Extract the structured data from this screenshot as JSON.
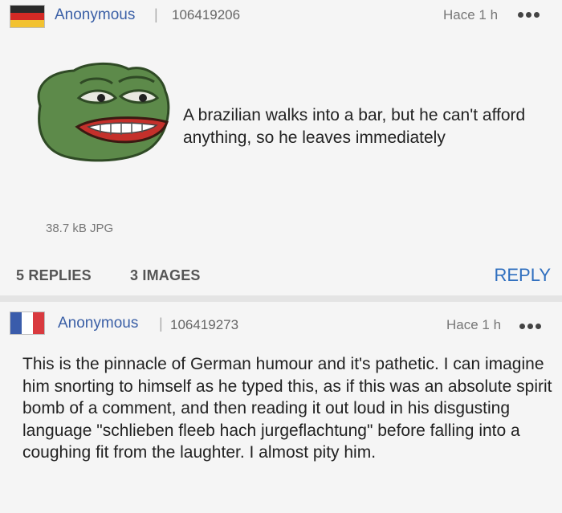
{
  "op": {
    "author": "Anonymous",
    "separator": "|",
    "post_id": "106419206",
    "time": "Hace 1 h",
    "more_icon": "more-dots-icon",
    "flag_icon": "germany-flag-icon",
    "flag_colors": [
      "#2a2a2a",
      "#d32a25",
      "#f2c230"
    ],
    "text": "A brazilian walks into a bar, but he can't afford anything, so he leaves immediately",
    "file_info": "38.7 kB JPG",
    "replies": "5 REPLIES",
    "images": "3 IMAGES",
    "reply_label": "REPLY"
  },
  "reply": {
    "author": "Anonymous",
    "separator": "|",
    "post_id": "106419273",
    "time": "Hace 1 h",
    "more_icon": "more-dots-icon",
    "flag_icon": "france-flag-icon",
    "flag_colors": [
      "#3a5cab",
      "#ffffff",
      "#d93a3f"
    ],
    "text": "This is the pinnacle of German humour and it's pathetic. I can imagine him snorting to himself as he typed this, as if this was an absolute spirit bomb of a comment, and then reading it out loud in his disgusting language \"schlieben fleeb hach jurgeflachtung\" before falling into a coughing fit from the laughter. I almost pity him."
  },
  "colors": {
    "accent": "#2f6fbf",
    "author": "#3a5fa6",
    "background": "#f5f5f5"
  }
}
